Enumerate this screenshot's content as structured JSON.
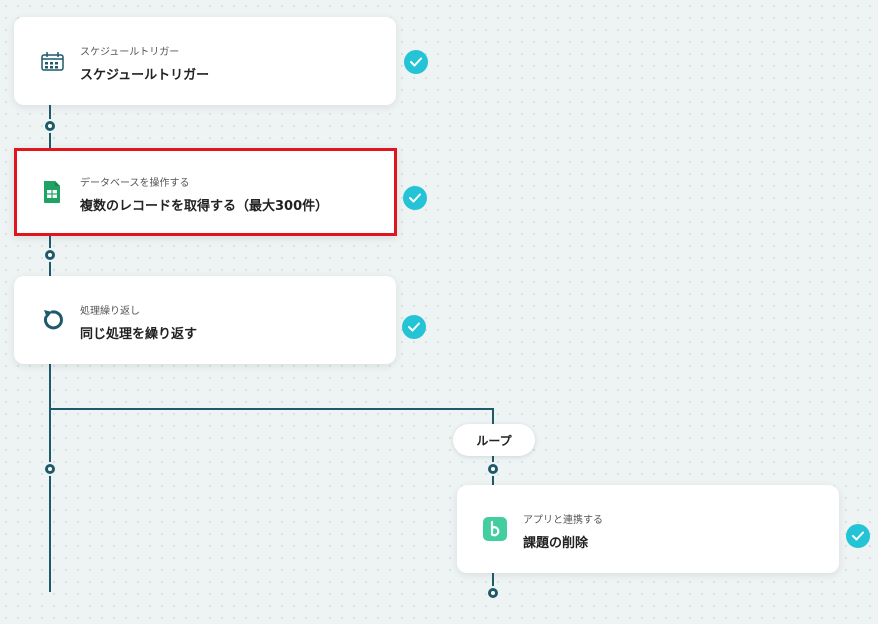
{
  "steps": [
    {
      "subtitle": "スケジュールトリガー",
      "title": "スケジュールトリガー",
      "icon": "calendar-icon"
    },
    {
      "subtitle": "データベースを操作する",
      "title": "複数のレコードを取得する（最大300件）",
      "icon": "google-sheets-icon"
    },
    {
      "subtitle": "処理繰り返し",
      "title": "同じ処理を繰り返す",
      "icon": "loop-arrow-icon"
    },
    {
      "subtitle": "アプリと連携する",
      "title": "課題の削除",
      "icon": "backlog-icon"
    }
  ],
  "loop_label": "ループ",
  "colors": {
    "connector": "#1f5a6b",
    "check": "#25c3d6",
    "highlight": "#e0161e",
    "sheets_green": "#1ea362",
    "backlog_green": "#42ce9f"
  }
}
